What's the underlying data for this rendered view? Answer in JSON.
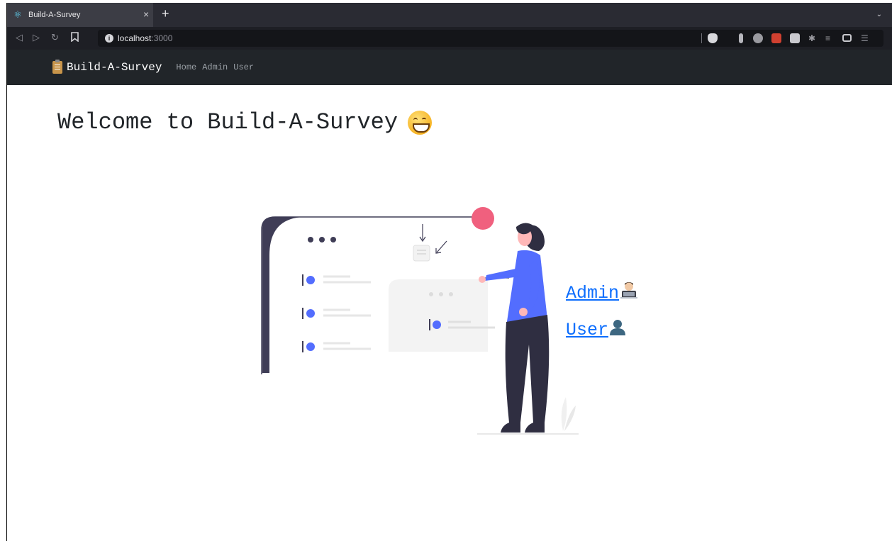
{
  "browser": {
    "tab_title": "Build-A-Survey",
    "tab_close": "×",
    "new_tab": "+",
    "tab_menu": "⌄",
    "url_host": "localhost",
    "url_port": ":3000"
  },
  "navbar": {
    "brand": "Build-A-Survey",
    "links": [
      "Home",
      "Admin",
      "User"
    ]
  },
  "main": {
    "heading": "Welcome to Build-A-Survey",
    "links": [
      {
        "label": "Admin",
        "icon": "technologist-icon"
      },
      {
        "label": "User",
        "icon": "user-silhouette-icon"
      }
    ]
  },
  "colors": {
    "link": "#0d6efd",
    "navbar_bg": "#212529",
    "accent_pink": "#f0607e",
    "accent_blue": "#536dfe"
  }
}
